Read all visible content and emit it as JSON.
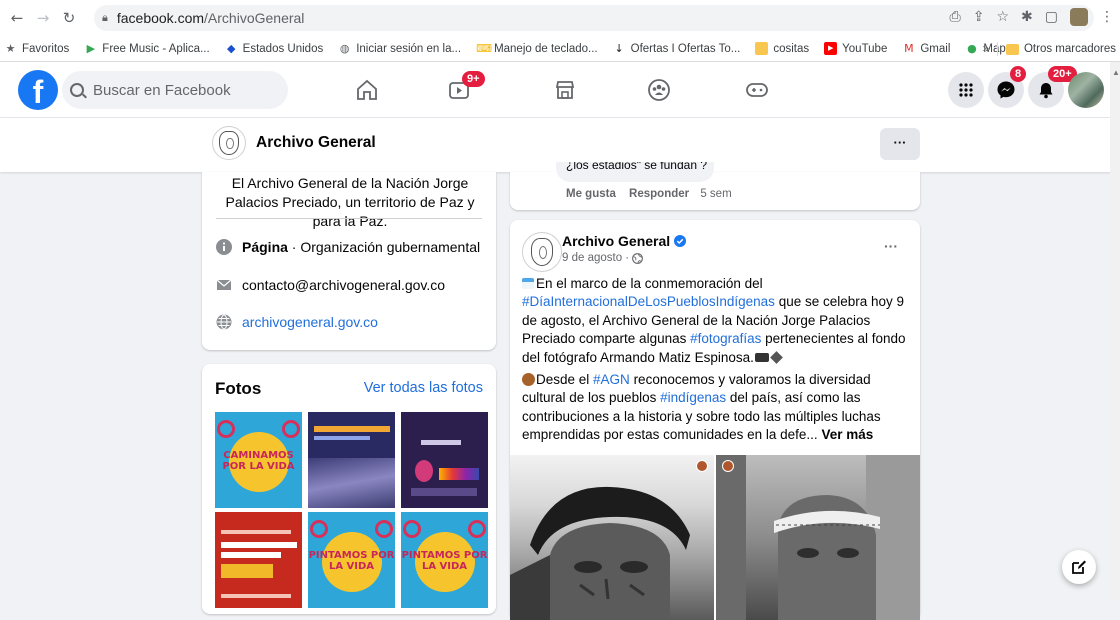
{
  "browser": {
    "url_host": "facebook.com",
    "url_path": "/ArchivoGeneral",
    "bookmarks": [
      {
        "label": "Favoritos",
        "icon": "star-icon",
        "color": "#5f6368"
      },
      {
        "label": "Free Music - Aplica...",
        "icon": "play-store-icon",
        "color": "#34a853"
      },
      {
        "label": "Estados Unidos",
        "icon": "flag-icon",
        "color": "#1a4fd1"
      },
      {
        "label": "Iniciar sesión en la...",
        "icon": "globe-icon",
        "color": "#5f6368"
      },
      {
        "label": "Manejo de teclado...",
        "icon": "keyboard-icon",
        "color": "#f4b400"
      },
      {
        "label": "Ofertas I Ofertas To...",
        "icon": "tool-icon",
        "color": "#202124"
      },
      {
        "label": "cositas",
        "icon": "folder-icon",
        "color": "#f9c74f"
      },
      {
        "label": "YouTube",
        "icon": "youtube-icon",
        "color": "#ff0000"
      },
      {
        "label": "Gmail",
        "icon": "gmail-icon",
        "color": "#d93025"
      },
      {
        "label": "Maps",
        "icon": "maps-icon",
        "color": "#34a853"
      }
    ],
    "more_label": "»",
    "other_bookmarks": "Otros marcadores"
  },
  "fb": {
    "search_placeholder": "Buscar en Facebook",
    "watch_badge": "9+",
    "messenger_badge": "8",
    "notifications_badge": "20+",
    "accent": "#1877f2",
    "badge_color": "#e41e3f"
  },
  "page": {
    "name": "Archivo General",
    "more": "···"
  },
  "intro": {
    "bio": "El Archivo General de la Nación Jorge Palacios Preciado, un territorio de Paz y para la Paz.",
    "category_bold": "Página",
    "category_rest": " · Organización gubernamental",
    "email": "contacto@archivogeneral.gov.co",
    "website": "archivogeneral.gov.co"
  },
  "photos": {
    "title": "Fotos",
    "see_all": "Ver todas las fotos",
    "tiles": [
      {
        "kind": "CAMINAMOS POR LA VIDA",
        "bg": "#2ea7d8"
      },
      {
        "kind": "ORGANIZACIÓN DE DOCUMENTOS",
        "bg": "#2a2a62"
      },
      {
        "kind": "El Archivo General de la Nación",
        "bg": "#2c1f4d"
      },
      {
        "kind": "La Memoria de la Nación",
        "bg": "#c62a1e"
      },
      {
        "kind": "PINTAMOS POR LA VIDA",
        "bg": "#2ea7d8"
      },
      {
        "kind": "PINTAMOS POR LA VIDA",
        "bg": "#2ea7d8"
      }
    ]
  },
  "comment": {
    "partial_text": "¿los estadios\" se fundan ?",
    "like": "Me gusta",
    "reply": "Responder",
    "time": "5 sem"
  },
  "post": {
    "author": "Archivo General",
    "date": "9 de agosto · ",
    "more": "···",
    "p1_a": "En el marco de la conmemoración del ",
    "p1_tag1": "#DíaInternacionalDeLosPueblosIndígenas",
    "p1_b": " que se celebra hoy 9 de agosto, el Archivo General de la Nación Jorge Palacios Preciado comparte algunas ",
    "p1_tag2": "#fotografías",
    "p1_c": " pertenecientes al fondo del fotógrafo Armando Matiz Espinosa.",
    "p2_a": "Desde el ",
    "p2_tag1": "#AGN",
    "p2_b": " reconocemos y valoramos la diversidad cultural de los pueblos ",
    "p2_tag2": "#indígenas",
    "p2_c": " del país, así como las contribuciones a la historia y sobre todo las múltiples luchas emprendidas por estas comunidades en la defe... ",
    "see_more": "Ver más"
  }
}
